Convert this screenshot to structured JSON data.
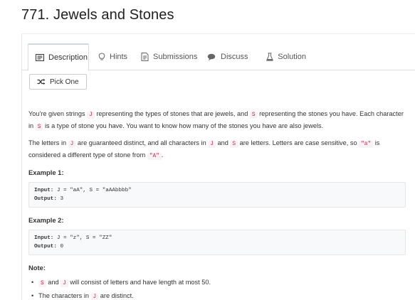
{
  "problem": {
    "title": "771. Jewels and Stones"
  },
  "tabs": [
    {
      "label": "Description",
      "icon": "description-icon",
      "active": true
    },
    {
      "label": "Hints",
      "icon": "lightbulb-icon"
    },
    {
      "label": "Submissions",
      "icon": "submissions-icon"
    },
    {
      "label": "Discuss",
      "icon": "discuss-icon"
    },
    {
      "label": "Solution",
      "icon": "flask-icon"
    }
  ],
  "pick_one": {
    "label": "Pick One",
    "icon": "shuffle-icon"
  },
  "description": {
    "p1": {
      "t1": "You're given strings ",
      "c1": "J",
      "t2": " representing the types of stones that are jewels, and ",
      "c2": "S",
      "t3": " representing the stones you have.  Each character in ",
      "c3": "S",
      "t4": " is a type of stone you have.  You want to know how many of the stones you have are also jewels."
    },
    "p2": {
      "t1": "The letters in ",
      "c1": "J",
      "t2": " are guaranteed distinct, and all characters in ",
      "c2": "J",
      "t3": " and ",
      "c3": "S",
      "t4": " are letters. Letters are case sensitive, so ",
      "c4": "\"a\"",
      "t5": " is considered a different type of stone from ",
      "c5": "\"A\"",
      "t6": "."
    },
    "example1": {
      "heading": "Example 1:",
      "input_label": "Input:",
      "input_value": " J = \"aA\", S = \"aAAbbbb\"",
      "output_label": "Output:",
      "output_value": " 3"
    },
    "example2": {
      "heading": "Example 2:",
      "input_label": "Input:",
      "input_value": " J = \"z\", S = \"ZZ\"",
      "output_label": "Output:",
      "output_value": " 0"
    },
    "note": {
      "heading": "Note:",
      "item1": {
        "c1": "S",
        "t1": " and ",
        "c2": "J",
        "t2": " will consist of letters and have length at most 50."
      },
      "item2": {
        "t1": "The characters in ",
        "c1": "J",
        "t2": " are distinct."
      }
    }
  },
  "colors": {
    "code_text": "#c7254e",
    "code_bg": "#f9f2f4",
    "pre_bg": "#f7f9fa"
  }
}
